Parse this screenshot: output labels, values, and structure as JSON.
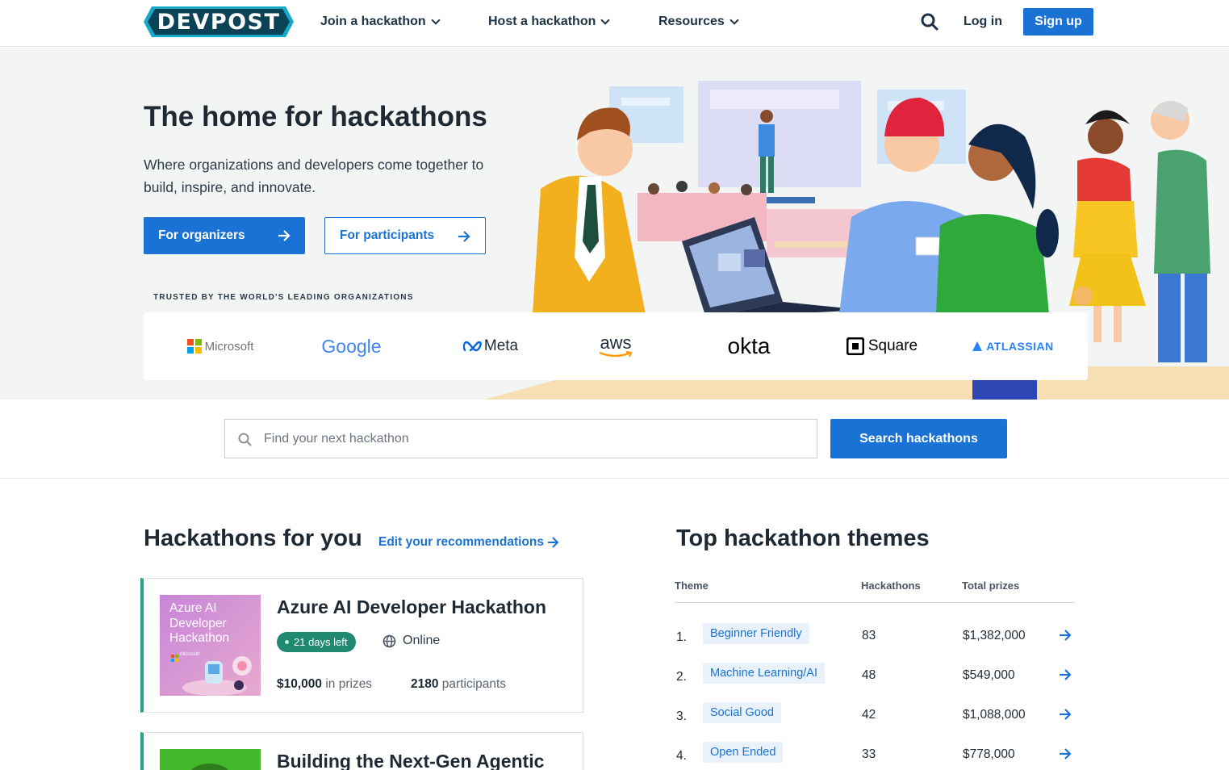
{
  "brand": {
    "name": "DEVPOST",
    "accent": "#1a73d4",
    "logo_bg": "#0b4255",
    "logo_edge": "#15a9c9"
  },
  "nav": {
    "links": [
      {
        "label": "Join a hackathon",
        "icon": "chevron-down-icon"
      },
      {
        "label": "Host a hackathon",
        "icon": "chevron-down-icon"
      },
      {
        "label": "Resources",
        "icon": "chevron-down-icon"
      }
    ],
    "search_icon": "search-icon",
    "login": "Log in",
    "signup": "Sign up"
  },
  "hero": {
    "title": "The home for hackathons",
    "subtitle": "Where organizations and developers come together to build, inspire, and innovate.",
    "cta_organizers": "For organizers",
    "cta_participants": "For participants",
    "trusted_label": "TRUSTED BY THE WORLD'S LEADING ORGANIZATIONS",
    "logos": [
      "Microsoft",
      "Google",
      "Meta",
      "aws",
      "okta",
      "Square",
      "ATLASSIAN"
    ]
  },
  "search": {
    "placeholder": "Find your next hackathon",
    "value": "",
    "button": "Search hackathons"
  },
  "recommendations": {
    "heading": "Hackathons for you",
    "edit_link": "Edit your recommendations",
    "cards": [
      {
        "title": "Azure AI Developer Hackathon",
        "thumb_text": "Azure AI Developer Hackathon",
        "thumb_brand": "Microsoft",
        "status": "21 days left",
        "location": "Online",
        "prize_amount": "$10,000",
        "prize_suffix": "in prizes",
        "participants_count": "2180",
        "participants_suffix": "participants"
      },
      {
        "title": "Building the Next-Gen Agentic"
      }
    ]
  },
  "themes": {
    "heading": "Top hackathon themes",
    "columns": [
      "Theme",
      "Hackathons",
      "Total prizes"
    ],
    "rows": [
      {
        "rank": "1.",
        "name": "Beginner Friendly",
        "count": "83",
        "prizes": "$1,382,000"
      },
      {
        "rank": "2.",
        "name": "Machine Learning/AI",
        "count": "48",
        "prizes": "$549,000"
      },
      {
        "rank": "3.",
        "name": "Social Good",
        "count": "42",
        "prizes": "$1,088,000"
      },
      {
        "rank": "4.",
        "name": "Open Ended",
        "count": "33",
        "prizes": "$778,000"
      }
    ]
  }
}
